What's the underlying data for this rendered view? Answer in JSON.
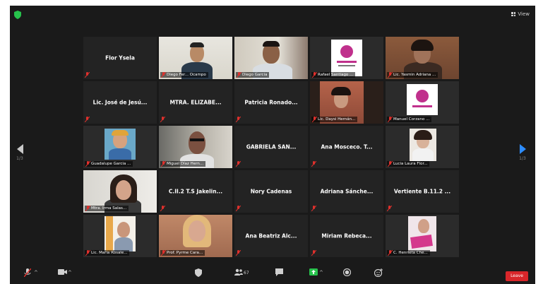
{
  "window": {
    "view_label": "View",
    "page_left": "1/3",
    "page_right": "1/3",
    "accent": "#2d8cff",
    "active_speaker_color": "#a8e03a",
    "end_color": "#d9262a"
  },
  "tiles": [
    {
      "name": "Flor Ysela",
      "type": "name"
    },
    {
      "name": "Diego Fer... Ocampo",
      "type": "video"
    },
    {
      "name": "Diego Garcia",
      "type": "video"
    },
    {
      "name": "Rafael Santiago ...",
      "type": "video"
    },
    {
      "name": "Lic. Yasmin Adriana ...",
      "type": "video"
    },
    {
      "name": "Lic. José de Jesú...",
      "type": "name"
    },
    {
      "name": "MTRA. ELIZABE...",
      "type": "name"
    },
    {
      "name": "Patricia Ronado...",
      "type": "name"
    },
    {
      "name": "Lic. Daysi Hernán...",
      "type": "video"
    },
    {
      "name": "Manuel Corzano ...",
      "type": "video"
    },
    {
      "name": "Guadalupe Garcia ...",
      "type": "video"
    },
    {
      "name": "Miguel Díaz Hern...",
      "type": "video"
    },
    {
      "name": "GABRIELA SAN...",
      "type": "name"
    },
    {
      "name": "Ana Mosceco. T...",
      "type": "name"
    },
    {
      "name": "Lucia Laura Flor...",
      "type": "video"
    },
    {
      "name": "Mtra. Irma Salas...",
      "type": "video"
    },
    {
      "name": "C.II.2 T.S Jakelin...",
      "type": "name"
    },
    {
      "name": "Nory Cadenas",
      "type": "name"
    },
    {
      "name": "Adriana Sánche...",
      "type": "name"
    },
    {
      "name": "Vertiente B.11.2 ...",
      "type": "name"
    },
    {
      "name": "Lic. María Rosale...",
      "type": "video"
    },
    {
      "name": "Prof. Pyrme Cara...",
      "type": "video"
    },
    {
      "name": "Ana Beatriz Alc...",
      "type": "name"
    },
    {
      "name": "Miriam Rebeca...",
      "type": "name"
    },
    {
      "name": "C. Henrieta Che...",
      "type": "video"
    }
  ],
  "toolbar": {
    "participants_count": "67",
    "end_label": "Leave"
  }
}
